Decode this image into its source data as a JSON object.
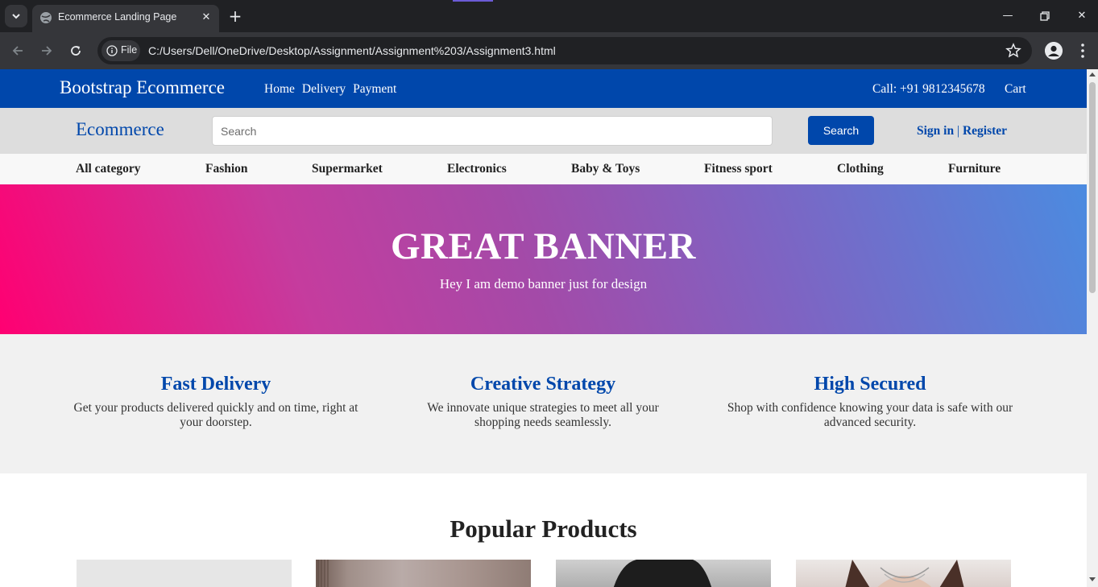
{
  "browser": {
    "tab_title": "Ecommerce Landing Page",
    "site_chip": "File",
    "url": "C:/Users/Dell/OneDrive/Desktop/Assignment/Assignment%203/Assignment3.html"
  },
  "topbar": {
    "brand": "Bootstrap Ecommerce",
    "nav": [
      "Home",
      "Delivery",
      "Payment"
    ],
    "call": "Call: +91 9812345678",
    "cart": "Cart"
  },
  "searchbar": {
    "logo": "Ecommerce",
    "placeholder": "Search",
    "button": "Search",
    "sign_in": "Sign in",
    "separator": "|",
    "register": "Register"
  },
  "categories": [
    "All category",
    "Fashion",
    "Supermarket",
    "Electronics",
    "Baby & Toys",
    "Fitness sport",
    "Clothing",
    "Furniture"
  ],
  "banner": {
    "title": "GREAT BANNER",
    "subtitle": "Hey I am demo banner just for design"
  },
  "features": [
    {
      "title": "Fast Delivery",
      "text": "Get your products delivered quickly and on time, right at your doorstep."
    },
    {
      "title": "Creative Strategy",
      "text": "We innovate unique strategies to meet all your shopping needs seamlessly."
    },
    {
      "title": "High Secured",
      "text": "Shop with confidence knowing your data is safe with our advanced security."
    }
  ],
  "products": {
    "title": "Popular Products"
  },
  "colors": {
    "primary_blue": "#0047ab",
    "banner_start": "#ff0072",
    "banner_end": "#4b8be0"
  }
}
